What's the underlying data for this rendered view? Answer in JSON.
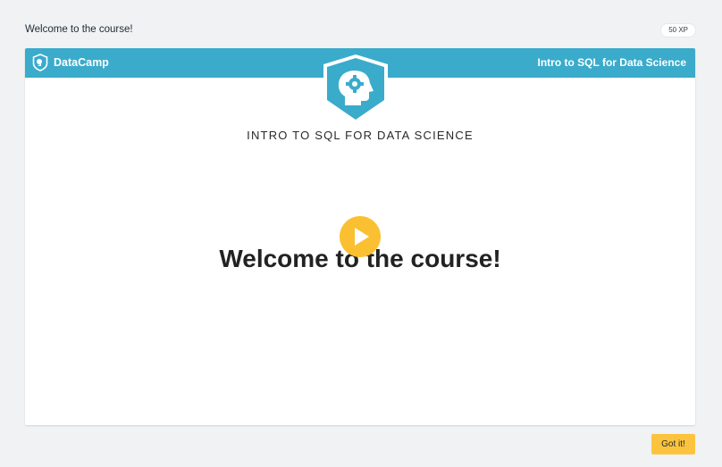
{
  "exercise": {
    "title": "Welcome to the course!",
    "xp": "50 XP"
  },
  "slide": {
    "brand": "DataCamp",
    "course_name": "Intro to SQL for Data Science",
    "subtitle": "INTRO TO SQL FOR DATA SCIENCE",
    "heading": "Welcome to the course!"
  },
  "footer": {
    "got_it_label": "Got it!"
  },
  "colors": {
    "header_blue": "#3aabcb",
    "play_yellow": "#fbc031",
    "button_yellow": "#fcc43e",
    "background": "#f0f2f4"
  },
  "icons": {
    "brand": "datacamp-logo-icon",
    "course": "head-gear-shield-icon",
    "play": "play-icon"
  }
}
